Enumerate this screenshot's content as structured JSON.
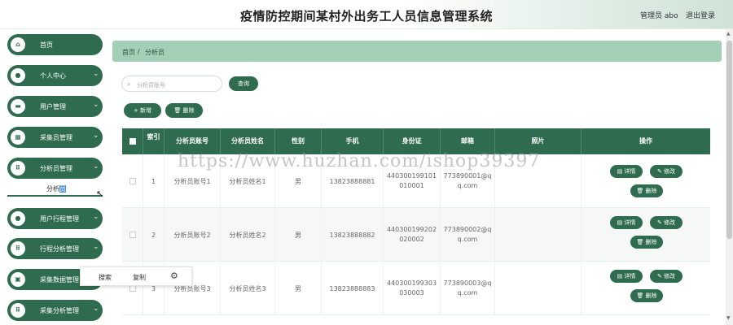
{
  "header": {
    "title": "疫情防控期间某村外出务工人员信息管理系统",
    "admin": "管理员 abo",
    "logout": "退出登录"
  },
  "sidebar": {
    "items": [
      {
        "label": "首页",
        "icon": "home-icon",
        "glyph": "⌂",
        "chevron": false
      },
      {
        "label": "个人中心",
        "icon": "person-icon",
        "glyph": "●",
        "chevron": true
      },
      {
        "label": "用户管理",
        "icon": "id-card-icon",
        "glyph": "▬",
        "chevron": true
      },
      {
        "label": "采集员管理",
        "icon": "grid-icon",
        "glyph": "▦",
        "chevron": true
      },
      {
        "label": "分析员管理",
        "icon": "apps-icon",
        "glyph": "⠿",
        "chevron": true
      },
      {
        "label": "用户行程管理",
        "icon": "route-icon",
        "glyph": "●",
        "chevron": true
      },
      {
        "label": "行程分析管理",
        "icon": "apps-icon",
        "glyph": "⠿",
        "chevron": true
      },
      {
        "label": "采集数据管理",
        "icon": "clipboard-icon",
        "glyph": "▣",
        "chevron": false
      },
      {
        "label": "采集分析管理",
        "icon": "apps-icon",
        "glyph": "⠿",
        "chevron": true
      }
    ],
    "chevron": "⌄",
    "sub_item": {
      "prefix": "分析",
      "selected": "员"
    }
  },
  "breadcrumb": {
    "home": "首页",
    "sep": "/",
    "current": "分析员"
  },
  "search": {
    "placeholder": "分析员账号",
    "button": "查询"
  },
  "actions": {
    "add": "+ 新增",
    "delete": "🗑 删除"
  },
  "table": {
    "headers": [
      "索引",
      "分析员账号",
      "分析员姓名",
      "性别",
      "手机",
      "身份证",
      "邮箱",
      "照片",
      "操作"
    ],
    "rows": [
      {
        "index": "1",
        "account": "分析员账号1",
        "name": "分析员姓名1",
        "gender": "男",
        "phone": "13823888881",
        "idcard": "440300199101010001",
        "email": "773890001@qq.com",
        "photo": ""
      },
      {
        "index": "2",
        "account": "分析员账号2",
        "name": "分析员姓名2",
        "gender": "男",
        "phone": "13823888882",
        "idcard": "440300199202020002",
        "email": "773890002@qq.com",
        "photo": ""
      },
      {
        "index": "3",
        "account": "分析员账号3",
        "name": "分析员姓名3",
        "gender": "男",
        "phone": "13823888883",
        "idcard": "440300199303030003",
        "email": "773890003@qq.com",
        "photo": ""
      }
    ],
    "row_actions": {
      "detail": "▤ 详情",
      "edit": "✎ 修改",
      "delete": "🗑 删除"
    }
  },
  "context_menu": {
    "search": "搜索",
    "copy": "复制",
    "settings_icon": "⚙"
  },
  "watermark": "https://www.huzhan.com/ishop39397",
  "colors": {
    "primary": "#2f6b4f",
    "breadcrumb_bg": "#a3cfb6"
  }
}
